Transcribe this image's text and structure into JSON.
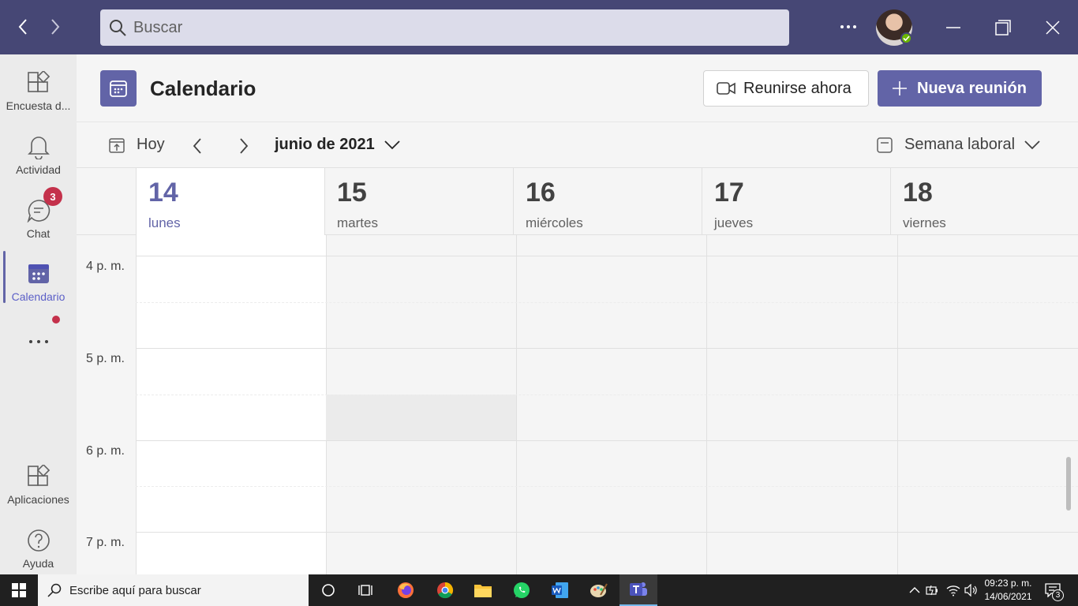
{
  "titlebar": {
    "search": {
      "placeholder": "Buscar"
    }
  },
  "rail": {
    "items": [
      {
        "label": "Encuesta d...",
        "icon": "apps-icon"
      },
      {
        "label": "Actividad",
        "icon": "bell-icon"
      },
      {
        "label": "Chat",
        "icon": "chat-icon",
        "badge": "3"
      },
      {
        "label": "Calendario",
        "icon": "calendar-icon",
        "active": true
      },
      {
        "label": "Aplicaciones",
        "icon": "apps-icon"
      },
      {
        "label": "Ayuda",
        "icon": "help-icon"
      }
    ]
  },
  "header": {
    "title": "Calendario",
    "meet_now_label": "Reunirse ahora",
    "new_meeting_label": "Nueva reunión"
  },
  "toolbar": {
    "today_label": "Hoy",
    "month_label": "junio de 2021",
    "view_label": "Semana laboral"
  },
  "days": [
    {
      "num": "14",
      "name": "lunes",
      "today": true
    },
    {
      "num": "15",
      "name": "martes"
    },
    {
      "num": "16",
      "name": "miércoles"
    },
    {
      "num": "17",
      "name": "jueves"
    },
    {
      "num": "18",
      "name": "viernes"
    }
  ],
  "times": [
    "4 p. m.",
    "5 p. m.",
    "6 p. m.",
    "7 p. m."
  ],
  "taskbar": {
    "search_placeholder": "Escribe aquí para buscar",
    "time": "09:23 p. m.",
    "date": "14/06/2021",
    "notifications": "3"
  },
  "colors": {
    "titlebar": "#464775",
    "accent": "#6264a7",
    "badge": "#c4314b",
    "presence": "#6bb700"
  }
}
